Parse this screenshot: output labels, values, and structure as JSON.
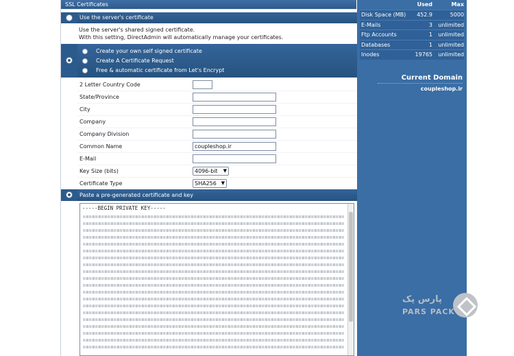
{
  "section_title": "SSL Certificates",
  "option_server": {
    "label": "Use the server's certificate",
    "desc_line1": "Use the server's shared signed certificate.",
    "desc_line2": "With this setting, DirectAdmin will automatically manage your certificates."
  },
  "option_group": {
    "items": [
      "Create your own self signed certificate",
      "Create A Certificate Request",
      "Free & automatic certificate from Let's Encrypt"
    ]
  },
  "form": {
    "country_label": "2 Letter Country Code",
    "country_value": "",
    "state_label": "State/Province",
    "state_value": "",
    "city_label": "City",
    "city_value": "",
    "company_label": "Company",
    "company_value": "",
    "division_label": "Company Division",
    "division_value": "",
    "common_name_label": "Common Name",
    "common_name_value": "coupleshop.ir",
    "email_label": "E-Mail",
    "email_value": "",
    "key_size_label": "Key Size (bits)",
    "key_size_value": "4096-bit",
    "cert_type_label": "Certificate Type",
    "cert_type_value": "SHA256"
  },
  "option_paste": {
    "label": "Paste a pre-generated certificate and key",
    "textarea_first_line": "-----BEGIN PRIVATE KEY-----"
  },
  "stats": {
    "headers": {
      "used": "Used",
      "max": "Max"
    },
    "rows": [
      {
        "name": "Disk Space (MB)",
        "used": "452.9",
        "max": "5000"
      },
      {
        "name": "E-Mails",
        "used": "3",
        "max": "unlimited"
      },
      {
        "name": "Ftp Accounts",
        "used": "1",
        "max": "unlimited"
      },
      {
        "name": "Databases",
        "used": "1",
        "max": "unlimited"
      },
      {
        "name": "Inodes",
        "used": "19765",
        "max": "unlimited"
      }
    ]
  },
  "current_domain": {
    "title": "Current Domain",
    "value": "coupleshop.ir"
  },
  "watermark": {
    "fa": "پارس پک",
    "en": "PARS PACK"
  }
}
